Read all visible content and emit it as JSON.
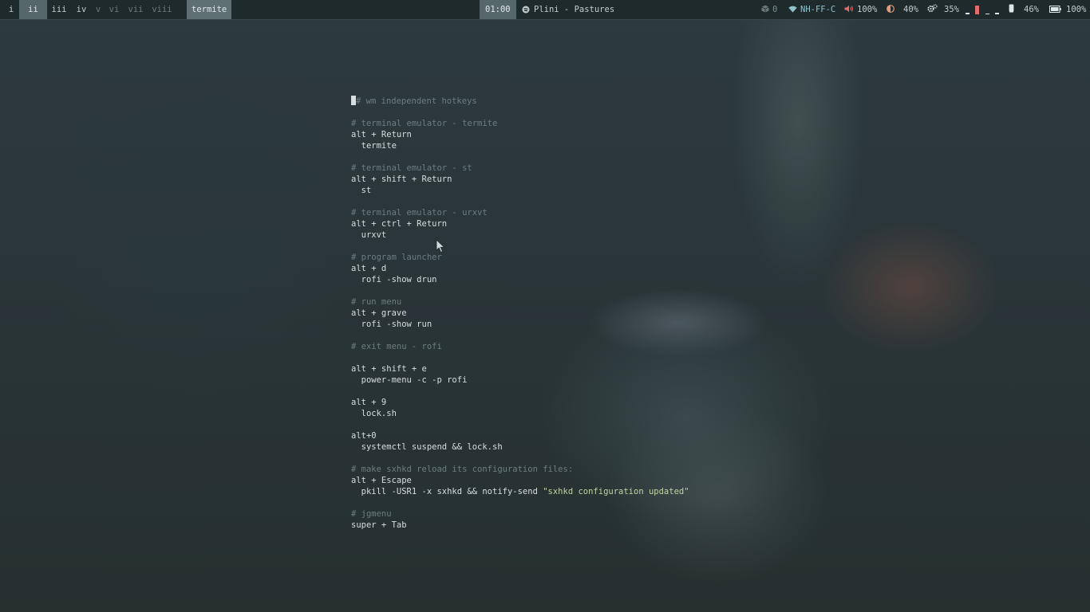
{
  "workspaces": [
    {
      "label": "i",
      "state": "normal"
    },
    {
      "label": "ii",
      "state": "active"
    },
    {
      "label": "iii",
      "state": "normal"
    },
    {
      "label": "iv",
      "state": "normal"
    },
    {
      "label": "v",
      "state": "dim"
    },
    {
      "label": "vi",
      "state": "dim"
    },
    {
      "label": "vii",
      "state": "dim"
    },
    {
      "label": "viii",
      "state": "dim"
    }
  ],
  "window_title": "termite",
  "clock": "01:00",
  "media": {
    "icon": "spotify-icon",
    "text": "Plini - Pastures"
  },
  "status": {
    "updates": "0",
    "wifi": "NH-FF-C",
    "volume": "100%",
    "brightness": "40%",
    "cpu": "35%",
    "memory": "46%",
    "battery": "100%"
  },
  "terminal": {
    "lines": [
      {
        "type": "first",
        "cursor_char": "#",
        "text": "## wm independent hotkeys"
      },
      {
        "type": "blank",
        "text": ""
      },
      {
        "type": "comment",
        "text": "# terminal emulator - termite"
      },
      {
        "type": "code",
        "text": "alt + Return"
      },
      {
        "type": "code",
        "text": "  termite"
      },
      {
        "type": "blank",
        "text": ""
      },
      {
        "type": "comment",
        "text": "# terminal emulator - st"
      },
      {
        "type": "code",
        "text": "alt + shift + Return"
      },
      {
        "type": "code",
        "text": "  st"
      },
      {
        "type": "blank",
        "text": ""
      },
      {
        "type": "comment",
        "text": "# terminal emulator - urxvt"
      },
      {
        "type": "code",
        "text": "alt + ctrl + Return"
      },
      {
        "type": "code",
        "text": "  urxvt"
      },
      {
        "type": "blank",
        "text": ""
      },
      {
        "type": "comment",
        "text": "# program launcher"
      },
      {
        "type": "code",
        "text": "alt + d"
      },
      {
        "type": "code",
        "text": "  rofi -show drun"
      },
      {
        "type": "blank",
        "text": ""
      },
      {
        "type": "comment",
        "text": "# run menu"
      },
      {
        "type": "code",
        "text": "alt + grave"
      },
      {
        "type": "code",
        "text": "  rofi -show run"
      },
      {
        "type": "blank",
        "text": ""
      },
      {
        "type": "comment",
        "text": "# exit menu - rofi"
      },
      {
        "type": "blank",
        "text": ""
      },
      {
        "type": "code",
        "text": "alt + shift + e"
      },
      {
        "type": "code",
        "text": "  power-menu -c -p rofi"
      },
      {
        "type": "blank",
        "text": ""
      },
      {
        "type": "code",
        "text": "alt + 9"
      },
      {
        "type": "code",
        "text": "  lock.sh"
      },
      {
        "type": "blank",
        "text": ""
      },
      {
        "type": "code",
        "text": "alt+0"
      },
      {
        "type": "code",
        "text": "  systemctl suspend && lock.sh"
      },
      {
        "type": "blank",
        "text": ""
      },
      {
        "type": "comment",
        "text": "# make sxhkd reload its configuration files:"
      },
      {
        "type": "code",
        "text": "alt + Escape"
      },
      {
        "type": "mixed",
        "text": "  pkill -USR1 -x sxhkd && notify-send ",
        "str": "\"sxhkd configuration updated\""
      },
      {
        "type": "blank",
        "text": ""
      },
      {
        "type": "comment",
        "text": "# jgmenu"
      },
      {
        "type": "code",
        "text": "super + Tab"
      }
    ]
  }
}
